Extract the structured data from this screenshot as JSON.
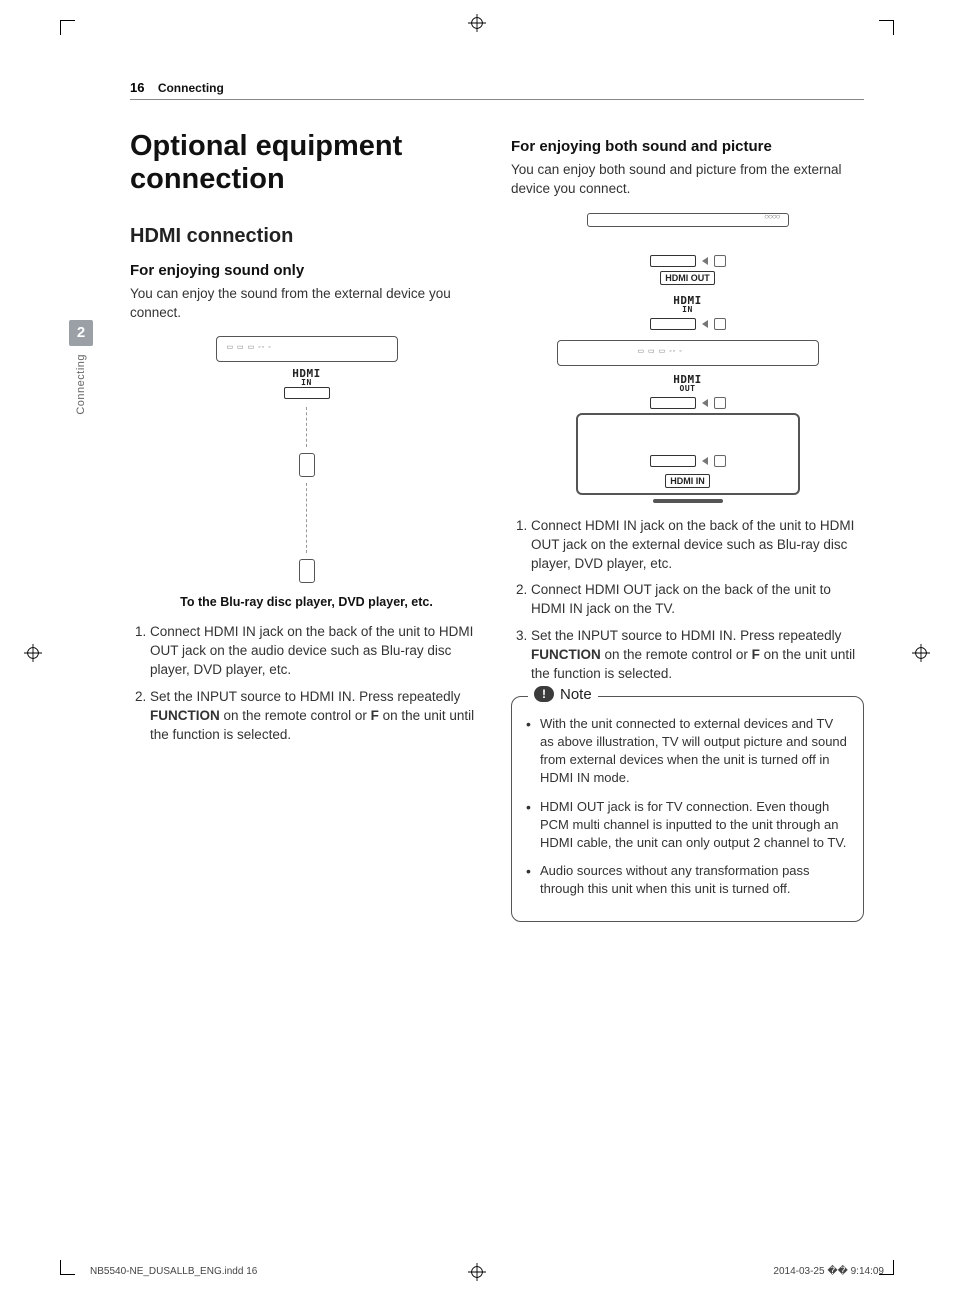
{
  "header": {
    "page_number": "16",
    "section": "Connecting"
  },
  "side_tab": {
    "chapter_number": "2",
    "chapter_label": "Connecting"
  },
  "main_title": "Optional equipment connection",
  "left": {
    "h2": "HDMI connection",
    "h3": "For enjoying sound only",
    "intro": "You can enjoy the sound from the external device you connect.",
    "fig_labels": {
      "hdmi": "HDMI",
      "hdmi_sub": "IN"
    },
    "fig_caption": "To the Blu-ray disc player, DVD player, etc.",
    "steps": [
      "Connect HDMI IN jack on the back of the unit to HDMI OUT jack on the audio device such as Blu-ray disc player, DVD player, etc.",
      "Set the INPUT source to HDMI IN. Press repeatedly FUNCTION on the remote control or F on the unit until the function is selected."
    ],
    "function_word": "FUNCTION",
    "f_letter": "F"
  },
  "right": {
    "h3": "For enjoying both sound and picture",
    "intro": "You can enjoy both sound and picture from the external device you connect.",
    "fig_labels": {
      "hdmi_out_box": "HDMI OUT",
      "hdmi_in_top": "HDMI",
      "hdmi_in_top_sub": "IN",
      "hdmi_out": "HDMI",
      "hdmi_out_sub": "OUT",
      "hdmi_in_box": "HDMI IN"
    },
    "steps": [
      "Connect HDMI IN jack on the back of the unit to HDMI OUT jack on the external device such as Blu-ray disc player, DVD player, etc.",
      "Connect HDMI OUT jack on the back of the unit to HDMI IN jack on the TV.",
      "Set the INPUT source to HDMI IN. Press repeatedly FUNCTION on the remote control or F on the unit until the function is selected."
    ],
    "function_word": "FUNCTION",
    "f_letter": "F",
    "note_label": "Note",
    "notes": [
      "With the unit connected to external devices and TV as above illustration, TV will output picture and sound from external devices when the unit is turned off in HDMI IN mode.",
      "HDMI OUT jack is for TV connection. Even though PCM multi channel is inputted to the unit through an HDMI cable, the unit can only output 2 channel to TV.",
      "Audio sources without any transformation pass through this unit when this unit is turned off."
    ]
  },
  "footer": {
    "file_ref": "NB5540-NE_DUSALLB_ENG.indd   16",
    "timestamp": "2014-03-25   �� 9:14:09"
  }
}
